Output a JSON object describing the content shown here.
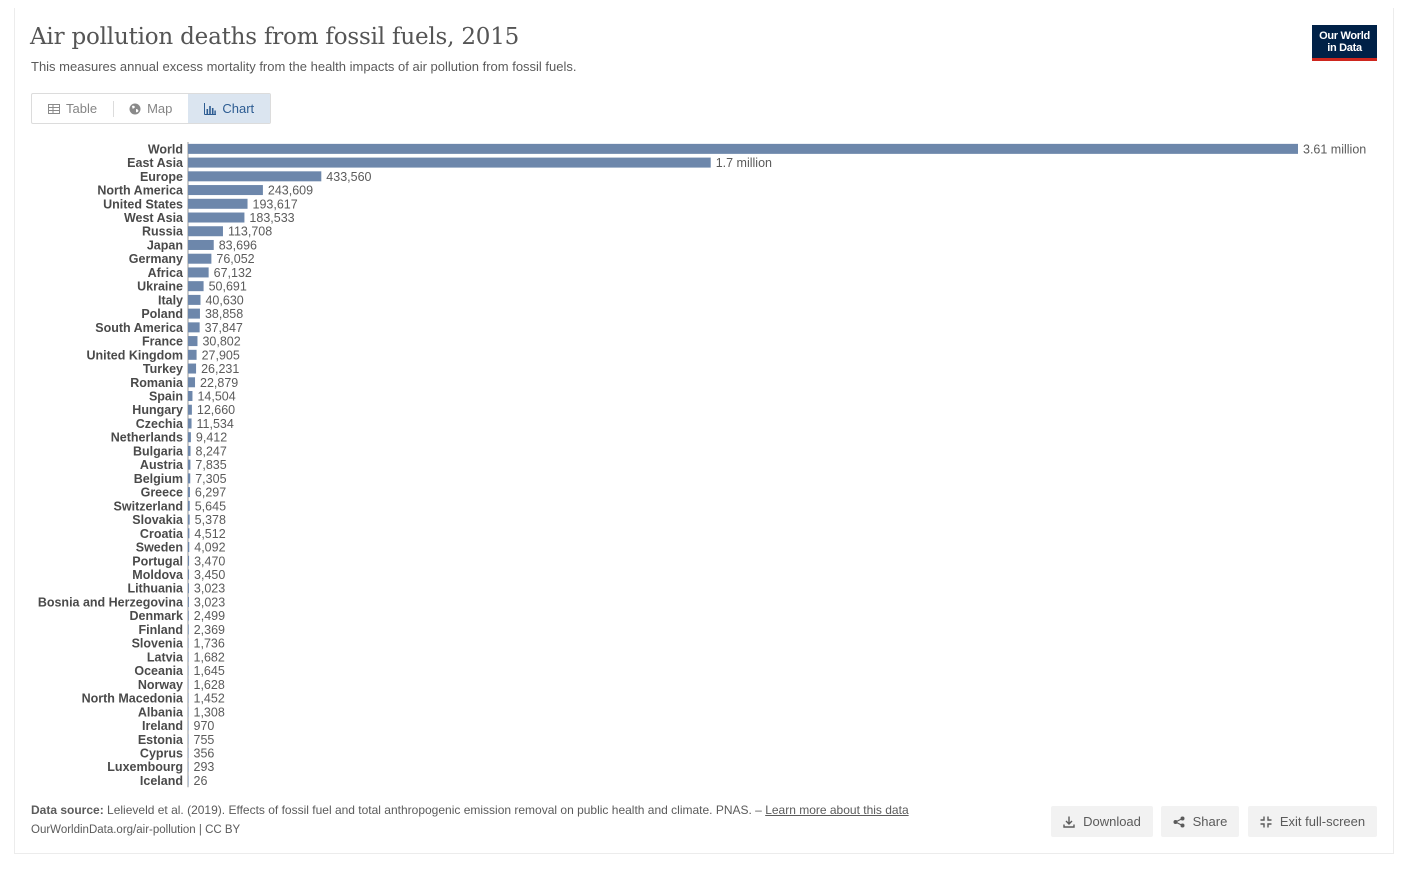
{
  "header": {
    "title": "Air pollution deaths from fossil fuels, 2015",
    "subtitle": "This measures annual excess mortality from the health impacts of air pollution from fossil fuels.",
    "logo_line1": "Our World",
    "logo_line2": "in Data"
  },
  "tabs": [
    {
      "label": "Table",
      "icon": "table-icon"
    },
    {
      "label": "Map",
      "icon": "globe-icon"
    },
    {
      "label": "Chart",
      "icon": "bar-chart-icon",
      "active": true
    }
  ],
  "chart_data": {
    "type": "bar",
    "orientation": "horizontal",
    "bar_color": "#6d87ab",
    "categories": [
      "World",
      "East Asia",
      "Europe",
      "North America",
      "United States",
      "West Asia",
      "Russia",
      "Japan",
      "Germany",
      "Africa",
      "Ukraine",
      "Italy",
      "Poland",
      "South America",
      "France",
      "United Kingdom",
      "Turkey",
      "Romania",
      "Spain",
      "Hungary",
      "Czechia",
      "Netherlands",
      "Bulgaria",
      "Austria",
      "Belgium",
      "Greece",
      "Switzerland",
      "Slovakia",
      "Croatia",
      "Sweden",
      "Portugal",
      "Moldova",
      "Lithuania",
      "Bosnia and Herzegovina",
      "Denmark",
      "Finland",
      "Slovenia",
      "Latvia",
      "Oceania",
      "Norway",
      "North Macedonia",
      "Albania",
      "Ireland",
      "Estonia",
      "Cyprus",
      "Luxembourg",
      "Iceland"
    ],
    "values": [
      3610000,
      1700000,
      433560,
      243609,
      193617,
      183533,
      113708,
      83696,
      76052,
      67132,
      50691,
      40630,
      38858,
      37847,
      30802,
      27905,
      26231,
      22879,
      14504,
      12660,
      11534,
      9412,
      8247,
      7835,
      7305,
      6297,
      5645,
      5378,
      4512,
      4092,
      3470,
      3450,
      3023,
      3023,
      2499,
      2369,
      1736,
      1682,
      1645,
      1628,
      1452,
      1308,
      970,
      755,
      356,
      293,
      26
    ],
    "value_labels": [
      "3.61 million",
      "1.7 million",
      "433,560",
      "243,609",
      "193,617",
      "183,533",
      "113,708",
      "83,696",
      "76,052",
      "67,132",
      "50,691",
      "40,630",
      "38,858",
      "37,847",
      "30,802",
      "27,905",
      "26,231",
      "22,879",
      "14,504",
      "12,660",
      "11,534",
      "9,412",
      "8,247",
      "7,835",
      "7,305",
      "6,297",
      "5,645",
      "5,378",
      "4,512",
      "4,092",
      "3,470",
      "3,450",
      "3,023",
      "3,023",
      "2,499",
      "2,369",
      "1,736",
      "1,682",
      "1,645",
      "1,628",
      "1,452",
      "1,308",
      "970",
      "755",
      "356",
      "293",
      "26"
    ]
  },
  "footer": {
    "source_label": "Data source:",
    "source_text": " Lelieveld et al. (2019). Effects of fossil fuel and total anthropogenic emission removal on public health and climate. PNAS. – ",
    "learn_more": "Learn more about this data",
    "url_license": "OurWorldinData.org/air-pollution | CC BY"
  },
  "actions": {
    "download": "Download",
    "share": "Share",
    "exit_fullscreen": "Exit full-screen"
  }
}
